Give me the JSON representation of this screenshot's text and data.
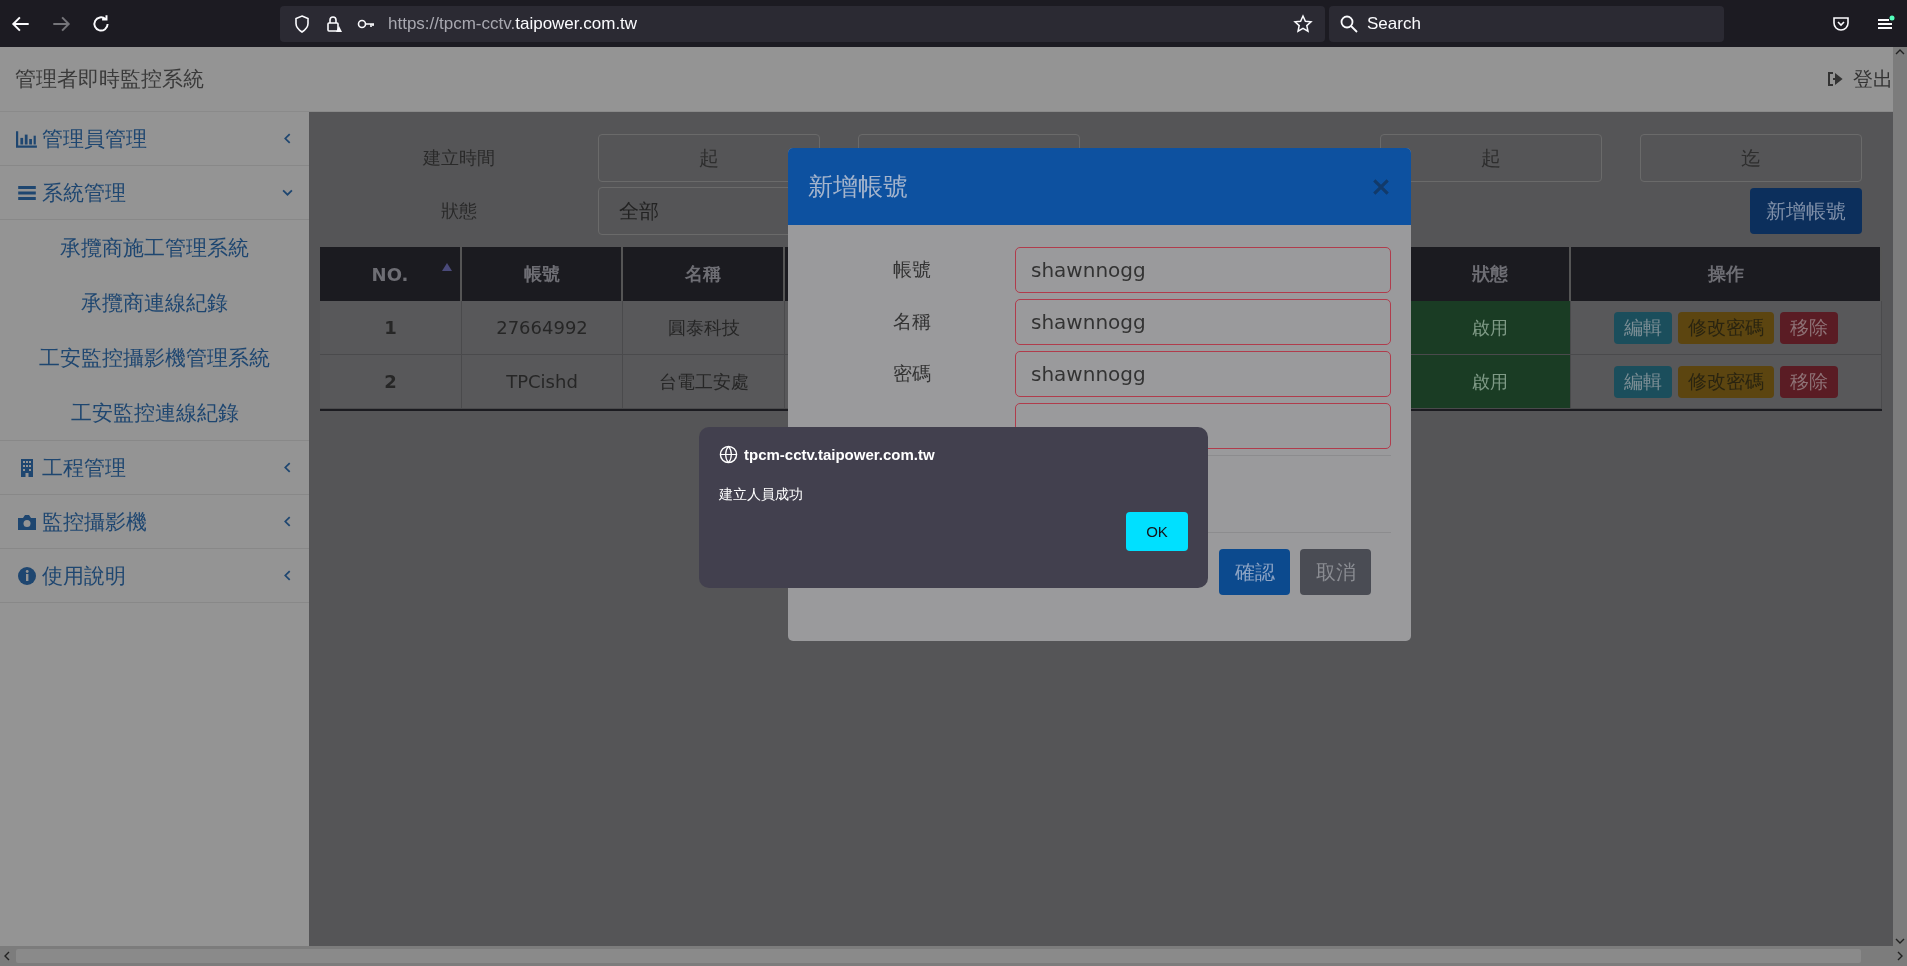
{
  "browser": {
    "back_disabled": false,
    "forward_disabled": true,
    "url_prefix": "https://tpcm-cctv.",
    "url_domain": "taipower.com.tw",
    "search_placeholder": "Search"
  },
  "app": {
    "title": "管理者即時監控系統",
    "logout": "登出"
  },
  "sidebar": {
    "items": [
      {
        "label": "管理員管理",
        "expanded": false
      },
      {
        "label": "系統管理",
        "expanded": true,
        "children": [
          {
            "label": "承攬商施工管理系統"
          },
          {
            "label": "承攬商連線紀錄"
          },
          {
            "label": "工安監控攝影機管理系統"
          },
          {
            "label": "工安監控連線紀錄"
          }
        ]
      },
      {
        "label": "工程管理",
        "expanded": false
      },
      {
        "label": "監控攝影機",
        "expanded": false
      },
      {
        "label": "使用說明",
        "expanded": false
      }
    ]
  },
  "filters": {
    "created_label": "建立時間",
    "created_from_placeholder": "起",
    "status_label": "狀態",
    "status_value": "全部",
    "range_from_placeholder": "起",
    "range_to_placeholder": "迄"
  },
  "add_button": "新增帳號",
  "table": {
    "columns": [
      {
        "label": "NO.",
        "sorted": true
      },
      {
        "label": "帳號",
        "sorted": false
      },
      {
        "label": "名稱",
        "sorted": false
      },
      {
        "label": "狀態",
        "sorted": false
      },
      {
        "label": "操作",
        "sorted": false
      }
    ],
    "rows": [
      {
        "no": "1",
        "account": "27664992",
        "name": "圓泰科技",
        "status": "啟用",
        "enabled": true,
        "actions": [
          {
            "label": "編輯",
            "kind": "edit"
          },
          {
            "label": "修改密碼",
            "kind": "password"
          },
          {
            "label": "移除",
            "kind": "remove"
          }
        ]
      },
      {
        "no": "2",
        "account": "TPCishd",
        "name": "台電工安處",
        "status": "啟用",
        "enabled": true,
        "actions": [
          {
            "label": "編輯",
            "kind": "edit"
          },
          {
            "label": "修改密碼",
            "kind": "password"
          },
          {
            "label": "移除",
            "kind": "remove"
          }
        ]
      }
    ]
  },
  "modal": {
    "title": "新增帳號",
    "fields": [
      {
        "label": "帳號",
        "value": "shawnnogg",
        "invalid": true
      },
      {
        "label": "名稱",
        "value": "shawnnogg",
        "invalid": true
      },
      {
        "label": "密碼",
        "value": "shawnnogg",
        "invalid": true
      }
    ],
    "buttons": [
      {
        "label": "確認",
        "kind": "primary"
      },
      {
        "label": "取消",
        "kind": "secondary"
      }
    ]
  },
  "alert": {
    "origin": "tpcm-cctv.taipower.com.tw",
    "message": "建立人員成功",
    "button": "OK"
  }
}
